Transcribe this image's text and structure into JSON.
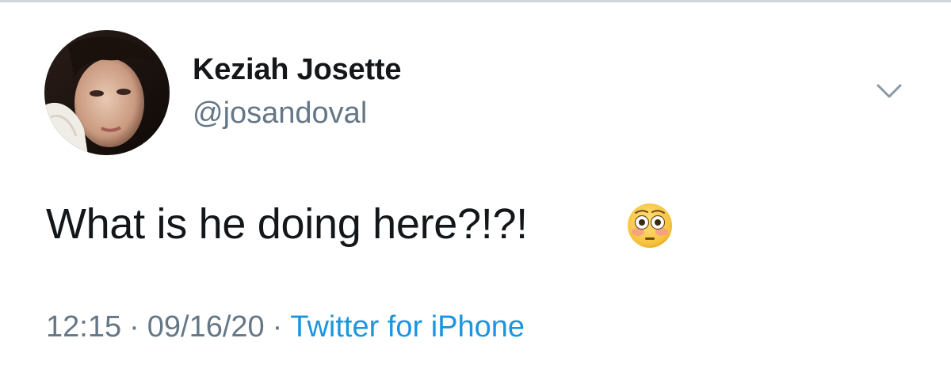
{
  "user": {
    "display_name": "Keziah Josette",
    "handle": "@josandoval"
  },
  "tweet": {
    "text": "What is he doing here?!?!",
    "emoji": "flushed-face"
  },
  "meta": {
    "time": "12:15",
    "separator": "·",
    "date": "09/16/20",
    "source": "Twitter for iPhone"
  },
  "icons": {
    "caret": "chevron-down-icon"
  },
  "colors": {
    "name": "#14171a",
    "secondary": "#657786",
    "link": "#1b95e0",
    "emoji_face": "#f6c23e"
  }
}
